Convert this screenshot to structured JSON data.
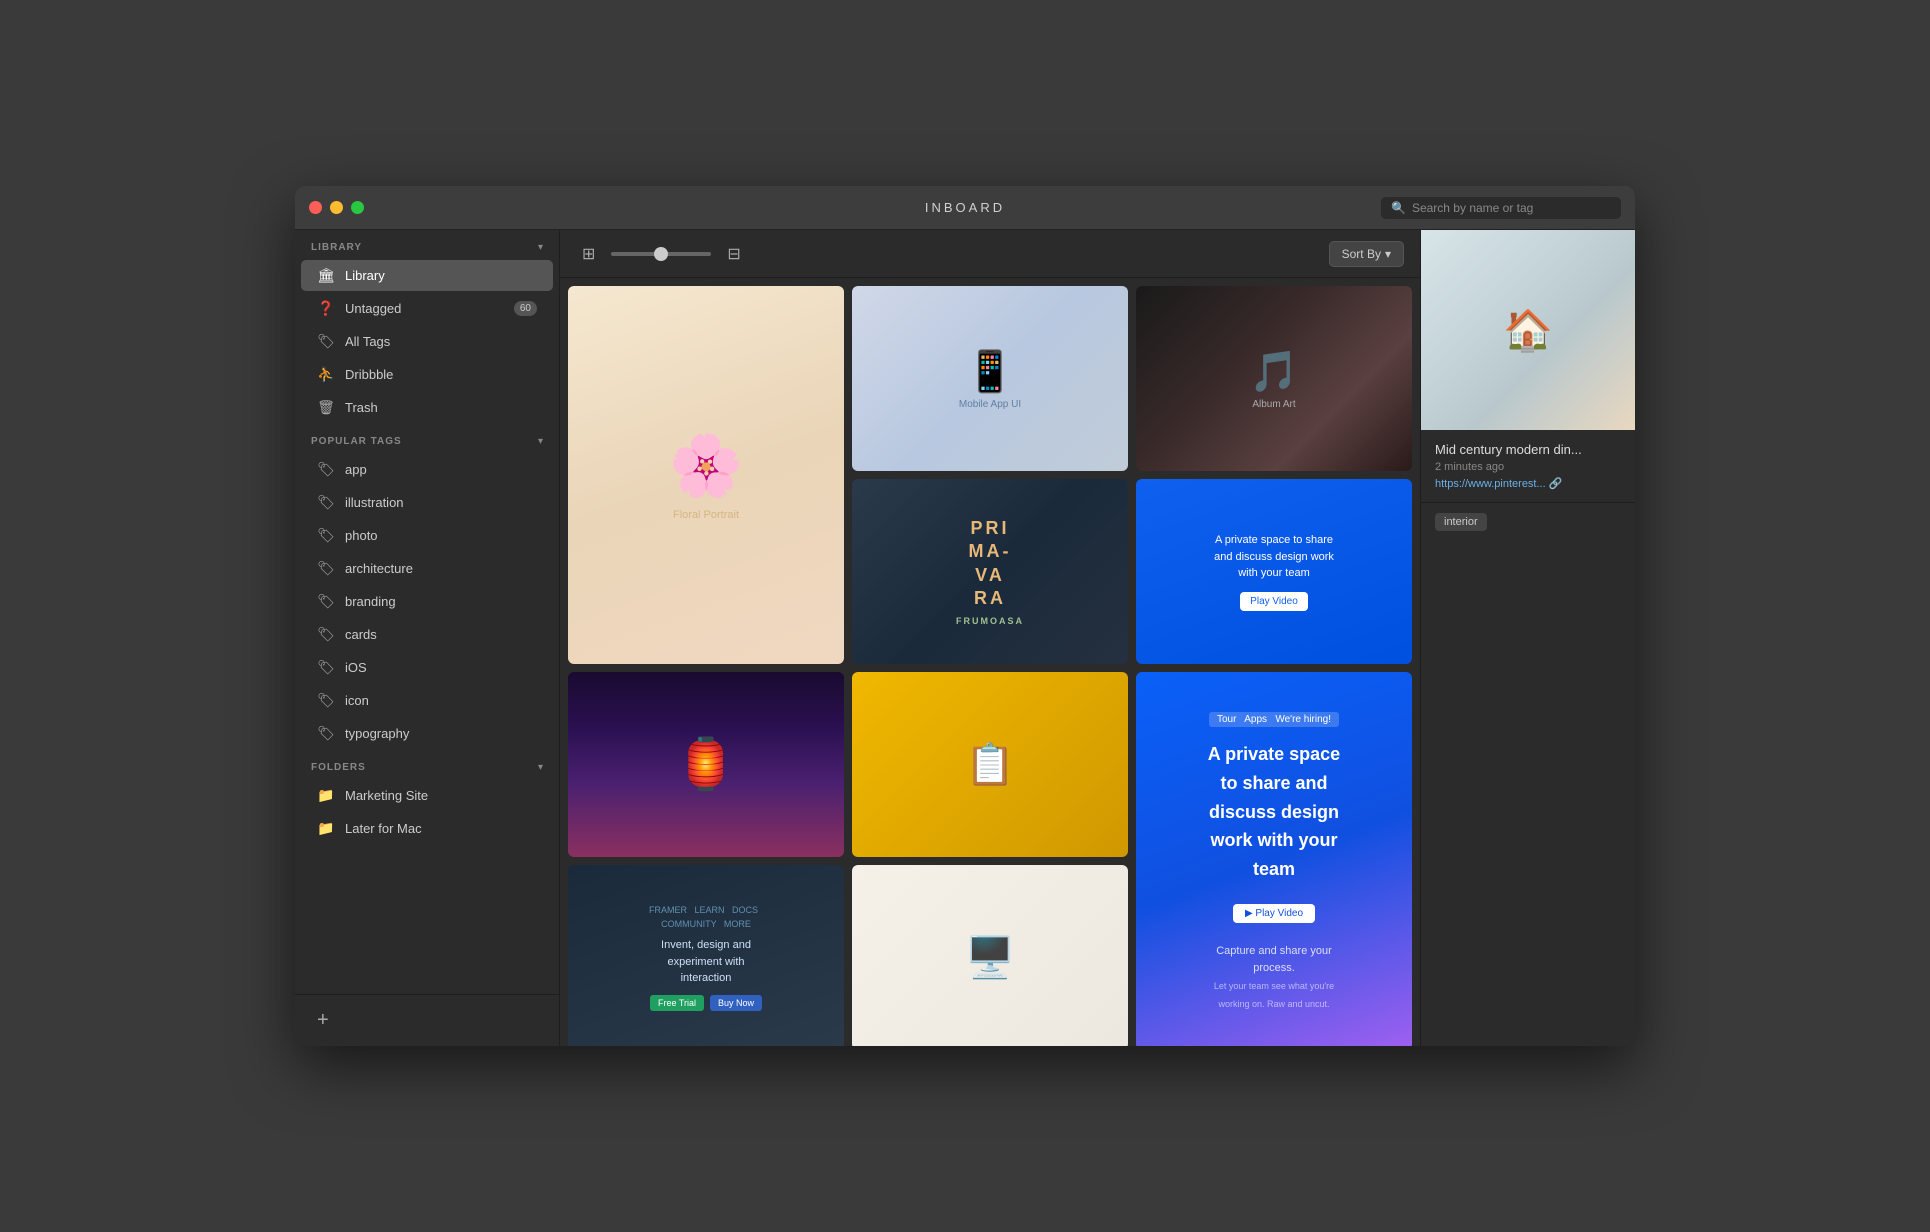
{
  "window": {
    "title": "INBOARD"
  },
  "titlebar": {
    "search_placeholder": "Search by name or tag"
  },
  "sidebar": {
    "library_section": "LIBRARY",
    "library_label": "Library",
    "untagged_label": "Untagged",
    "untagged_count": "60",
    "all_tags_label": "All Tags",
    "dribbble_label": "Dribbble",
    "trash_label": "Trash",
    "popular_tags_section": "POPULAR TAGS",
    "tags": [
      {
        "label": "app"
      },
      {
        "label": "illustration"
      },
      {
        "label": "photo"
      },
      {
        "label": "architecture"
      },
      {
        "label": "branding"
      },
      {
        "label": "cards"
      },
      {
        "label": "iOS"
      },
      {
        "label": "icon"
      },
      {
        "label": "typography"
      }
    ],
    "folders_section": "FOLDERS",
    "folders": [
      {
        "label": "Marketing Site"
      },
      {
        "label": "Later for Mac"
      }
    ],
    "add_button": "+"
  },
  "toolbar": {
    "sort_label": "Sort By",
    "sort_arrow": "▾"
  },
  "detail": {
    "title": "Mid century modern din...",
    "time": "2 minutes ago",
    "url": "https://www.pinterest...",
    "tags": [
      "interior"
    ]
  },
  "grid_items": [
    {
      "id": "floral-portrait",
      "type": "floral-portrait",
      "height": "tall",
      "icon": "🌸"
    },
    {
      "id": "phone-ui",
      "type": "phone-ui",
      "height": "short",
      "icon": "📱"
    },
    {
      "id": "album-art",
      "type": "album-art",
      "height": "short",
      "icon": "🎵"
    },
    {
      "id": "primavara",
      "type": "primavara",
      "height": "short",
      "text": "PRIMA\nVARA"
    },
    {
      "id": "blue-app",
      "type": "blue-app",
      "height": "short",
      "text": "A private space to share and discuss design work with your team"
    },
    {
      "id": "lighthouse",
      "type": "lighthouse",
      "height": "short",
      "icon": "🏮"
    },
    {
      "id": "yellow-card",
      "type": "yellow-card",
      "height": "short",
      "icon": "📋"
    },
    {
      "id": "framer-web",
      "type": "framer-web",
      "height": "short",
      "text": "Invent, design and experiment with interaction"
    },
    {
      "id": "workspace",
      "type": "workspace",
      "height": "short",
      "icon": "🖥️"
    },
    {
      "id": "team-collab",
      "type": "team-collab",
      "height": "short",
      "text": "Capture and share your process."
    }
  ]
}
